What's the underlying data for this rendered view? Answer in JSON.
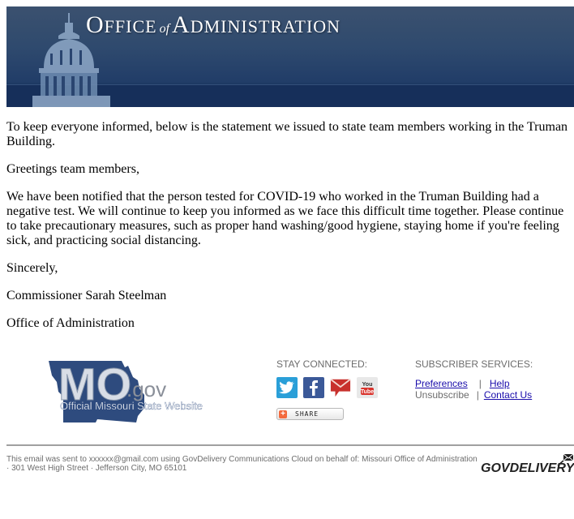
{
  "header": {
    "banner_title_parts": [
      "O",
      "FFICE",
      "of",
      "A",
      "DMINISTRATION"
    ],
    "banner_alt": "Office of Administration"
  },
  "body": {
    "paragraphs": [
      "To keep everyone informed, below is the statement we issued to state team members working in the Truman Building.",
      "Greetings team members,",
      "We have been notified that the person tested for COVID-19 who worked in the Truman Building had a negative test. We will continue to keep you informed as we face this difficult time together. Please continue to take precautionary measures, such as proper hand washing/good hygiene, staying home if you're feeling sick, and practicing social distancing.",
      "Sincerely,",
      "Commissioner Sarah Steelman",
      "Office of Administration"
    ]
  },
  "footer": {
    "mo_logo": {
      "main": "MO",
      "suffix": ".gov",
      "tagline": "Official Missouri State Website"
    },
    "stay_connected": {
      "heading": "STAY CONNECTED:",
      "icons": [
        {
          "name": "twitter-icon",
          "color": "#2a9fd8"
        },
        {
          "name": "facebook-icon",
          "color": "#3b5998"
        },
        {
          "name": "email-icon",
          "color": "#c0302a"
        },
        {
          "name": "youtube-icon",
          "color": "#e8e8e8"
        }
      ],
      "share_label": "SHARE"
    },
    "subscriber_services": {
      "heading": "SUBSCRIBER SERVICES:",
      "preferences": "Preferences",
      "help": "Help",
      "unsubscribe": "Unsubscribe",
      "contact_us": "Contact Us",
      "separator": "|"
    },
    "legal_line1": "This email was sent to xxxxxx@gmail.com using GovDelivery Communications Cloud on behalf of: Missouri Office of Administration",
    "legal_line2": "· 301 West High Street · Jefferson City, MO 65101",
    "govdelivery_logo": "GOVDELIVERY"
  },
  "colors": {
    "banner_dark": "#162f5a",
    "link": "#1a0dab",
    "muted_text": "#6d6d6d"
  }
}
